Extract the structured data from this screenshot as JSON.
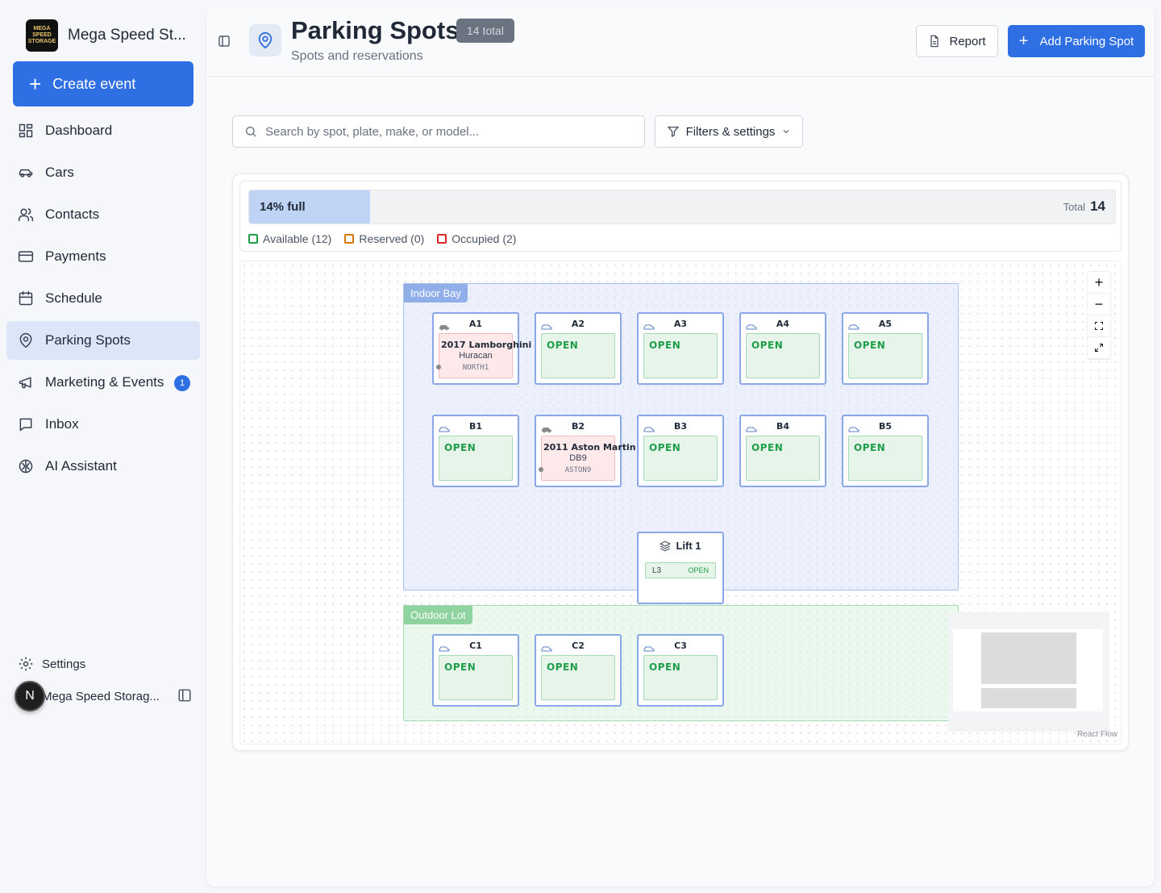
{
  "sidebar": {
    "brand_name": "Mega Speed St...",
    "brand_logo_text": "MEGA SPEED STORAGE",
    "create_label": "Create event",
    "items": [
      {
        "label": "Dashboard",
        "icon": "dashboard-icon"
      },
      {
        "label": "Cars",
        "icon": "car-icon"
      },
      {
        "label": "Contacts",
        "icon": "users-icon"
      },
      {
        "label": "Payments",
        "icon": "credit-card-icon"
      },
      {
        "label": "Schedule",
        "icon": "calendar-icon"
      },
      {
        "label": "Parking Spots",
        "icon": "map-pin-icon",
        "active": true
      },
      {
        "label": "Marketing & Events",
        "icon": "megaphone-icon",
        "badge": "1"
      },
      {
        "label": "Inbox",
        "icon": "inbox-icon"
      },
      {
        "label": "AI Assistant",
        "icon": "brain-icon"
      }
    ],
    "settings_label": "Settings",
    "user_initial": "N",
    "user_name": "Mega Speed Storag..."
  },
  "header": {
    "title": "Parking Spots",
    "total_badge": "14 total",
    "subtitle": "Spots and reservations",
    "report_label": "Report",
    "add_label": "Add Parking Spot"
  },
  "toolbar": {
    "search_placeholder": "Search by spot, plate, make, or model...",
    "filters_label": "Filters & settings"
  },
  "summary": {
    "occupancy_label": "14% full",
    "occupancy_fraction": 0.14,
    "total_label": "Total",
    "total_value": "14",
    "legend": [
      {
        "label": "Available (12)",
        "color": "#1e9e4a"
      },
      {
        "label": "Reserved (0)",
        "color": "#d97706"
      },
      {
        "label": "Occupied (2)",
        "color": "#dc2626"
      }
    ]
  },
  "zones": {
    "indoor": "Indoor Bay",
    "outdoor": "Outdoor Lot"
  },
  "spots": {
    "a1": {
      "code": "A1",
      "vehicle": "2017 Lamborghini",
      "model": "Huracan",
      "plate": "NORTH1"
    },
    "a2": {
      "code": "A2",
      "status": "OPEN"
    },
    "a3": {
      "code": "A3",
      "status": "OPEN"
    },
    "a4": {
      "code": "A4",
      "status": "OPEN"
    },
    "a5": {
      "code": "A5",
      "status": "OPEN"
    },
    "b1": {
      "code": "B1",
      "status": "OPEN"
    },
    "b2": {
      "code": "B2",
      "vehicle": "2011 Aston Martin",
      "model": "DB9",
      "plate": "ASTON9"
    },
    "b3": {
      "code": "B3",
      "status": "OPEN"
    },
    "b4": {
      "code": "B4",
      "status": "OPEN"
    },
    "b5": {
      "code": "B5",
      "status": "OPEN"
    },
    "c1": {
      "code": "C1",
      "status": "OPEN"
    },
    "c2": {
      "code": "C2",
      "status": "OPEN"
    },
    "c3": {
      "code": "C3",
      "status": "OPEN"
    }
  },
  "lift": {
    "name": "Lift 1",
    "level": "L3",
    "status": "OPEN"
  },
  "flow": {
    "attribution": "React Flow"
  },
  "colors": {
    "accent": "#2f6fe4",
    "open": "#1e9e4a",
    "occupied_bg": "#fde8ea"
  }
}
